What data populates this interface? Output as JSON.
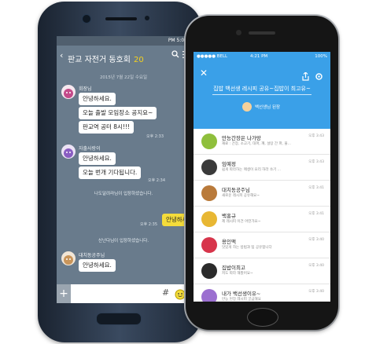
{
  "android": {
    "status_time": "PM 5:04",
    "room_title": "판교 자전거 동호회",
    "member_count": "20",
    "date_divider": "2015년 7월 22일 수요일",
    "messages": [
      {
        "sender": "회장님",
        "lines": [
          "안녕하세요.",
          "오늘 출발 모임장소 공지요~",
          "판교역 공터 8시!!!"
        ],
        "time": "오후 2:33"
      },
      {
        "sender": "자출사랑이",
        "lines": [
          "안녕하세요.",
          "오늘 번개 기다됩니다."
        ],
        "time": "오후 2:34"
      }
    ],
    "notice_1": "나도달려라님이 입장하셨습니다.",
    "my_message": {
      "text": "안녕하세요",
      "time": "오후 2:35"
    },
    "notice_2": "신난다님이 입장하셨습니다.",
    "last_message": {
      "sender": "대치동공주님",
      "text": "안녕하세요."
    },
    "input_plus": "+",
    "input_hash": "#"
  },
  "iphone": {
    "status_carrier": "●●●●● BELL",
    "status_time": "4:21 PM",
    "status_battery": "100%",
    "title": "집밥 백선생 레시피 공유~집밥이 최고유~",
    "host": "백선생님 된장",
    "rows": [
      {
        "name": "만능간장은 나가망",
        "sub": "재료 : 간장, 소고기, 대파, 깨, 설탕 간 파, 물...",
        "time": "오후 3:43"
      },
      {
        "name": "임예정",
        "sub": "쉽게 따라하는 매생이 요리 하라 쏘기 ...",
        "time": "오후 3:43"
      },
      {
        "name": "대치동공주님",
        "sub": "새로운 레시피 공유해요~",
        "time": "오후 3:41"
      },
      {
        "name": "백홍규",
        "sub": "제 레시피 이건 어떤가요~",
        "time": "오후 3:41"
      },
      {
        "name": "용인맥",
        "sub": "맛있게 하는 방법과 팁 공유합니다",
        "time": "오후 3:40"
      },
      {
        "name": "집밥이최고",
        "sub": "저도 따라 해봤어요~",
        "time": "오후 3:40"
      },
      {
        "name": "내가 백선생이유~",
        "sub": "만능 된장 레시피 궁금해요",
        "time": "오후 3:40"
      }
    ]
  },
  "colors": {
    "android_bg": "#697b8c",
    "kakao_yellow": "#f4dc3b",
    "iphone_header": "#3aa0e8"
  }
}
